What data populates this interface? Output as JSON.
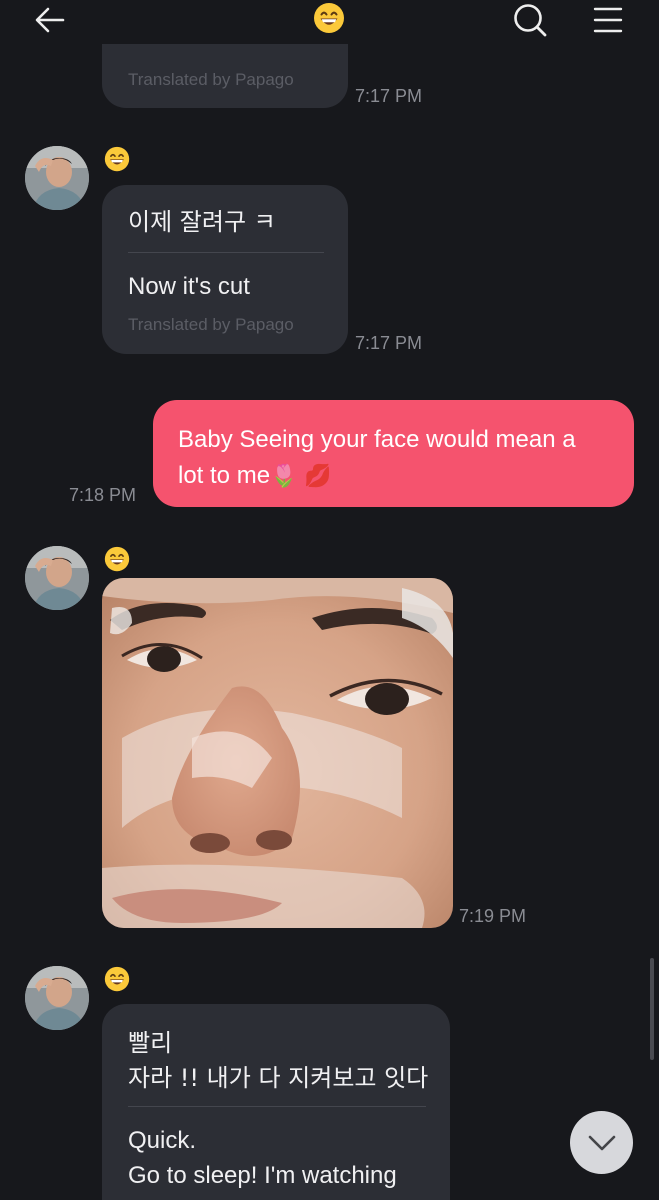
{
  "header": {
    "emoji": "😄",
    "icons": {
      "back": "back-arrow-icon",
      "emoji": "grinning-face-emoji",
      "search": "search-icon",
      "menu": "hamburger-menu-icon"
    }
  },
  "messages": [
    {
      "type": "incoming-translated",
      "partial": true,
      "translated_by": "Translated by Papago",
      "time": "7:17 PM"
    },
    {
      "type": "incoming-translated",
      "sender_emoji": "😄",
      "original": "이제 잘려구 ㅋ",
      "translation": "Now it's cut",
      "translated_by": "Translated by Papago",
      "time": "7:17 PM"
    },
    {
      "type": "outgoing",
      "text_line1": "Baby Seeing your face would mean a",
      "text_line2": "lot to me",
      "emojis": "🌷 💋",
      "time": "7:18 PM"
    },
    {
      "type": "incoming-photo",
      "sender_emoji": "😄",
      "time": "7:19 PM"
    },
    {
      "type": "incoming-translated",
      "sender_emoji": "😄",
      "original_line1": "빨리",
      "original_line2": "자라 !! 내가 다 지켜보고 잇다",
      "translation_line1": "Quick.",
      "translation_line2": "Go to sleep! I'm watching"
    }
  ],
  "colors": {
    "background": "#17181c",
    "incoming_bubble": "#2c2e35",
    "outgoing_bubble": "#f5536e",
    "timestamp": "#8a8c93",
    "papago": "#5b5d65"
  },
  "scroll_down_icon": "chevron-down-icon"
}
